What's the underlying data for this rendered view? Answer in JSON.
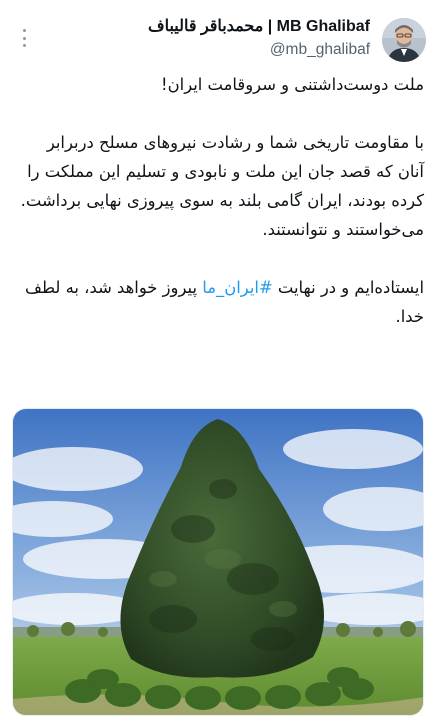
{
  "tweet": {
    "author": {
      "display_name": "محمدباقر قالیباف | MB Ghalibaf",
      "handle": "@mb_ghalibaf",
      "avatar_icon": "user-avatar"
    },
    "more_icon": "more-options-icon",
    "text": {
      "line1": "ملت دوست‌داشتنی و سروقامت ایران!",
      "para2": "با مقاومت تاریخی شما و رشادت نیروهای مسلح دربرابر آنان که قصد جان این ملت و نابودی و تسلیم این مملکت را کرده بودند، ایران گامی بلند به سوی پیروزی نهایی برداشت. می‌خواستند و نتوانستند.",
      "para3_before": "ایستاده‌ایم و در نهایت ",
      "hashtag": "#ایران_ما",
      "para3_after": " پیروز خواهد شد، به لطف خدا."
    },
    "colors": {
      "text": "#0f1419",
      "secondary": "#536471",
      "link": "#1d9bf0"
    }
  }
}
